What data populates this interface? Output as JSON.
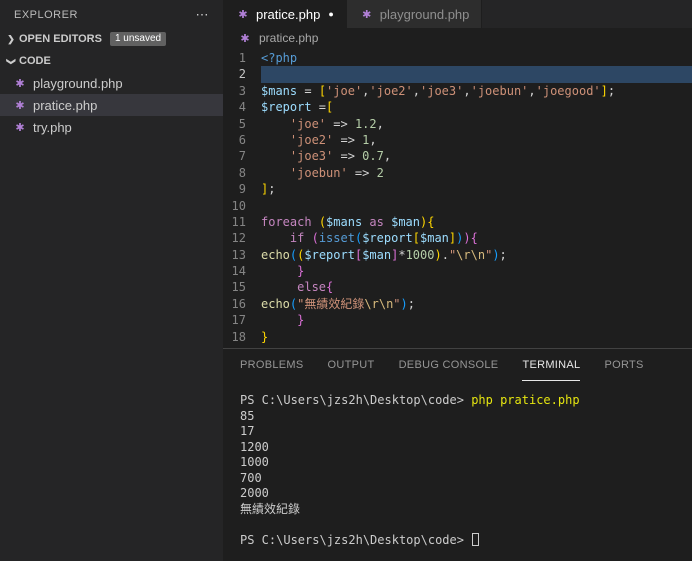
{
  "icons": {
    "php_file": "✱",
    "more": "⋯",
    "chevron_right": "❯",
    "modified_dot": "●"
  },
  "colors": {
    "php_icon_purple": "#b180d7",
    "sidebar_bg": "#252526",
    "editor_bg": "#1e1e1e",
    "selection_bg": "#37373d",
    "terminal_command_yellow": "#e5e510"
  },
  "sidebar": {
    "title": "EXPLORER",
    "open_editors": {
      "label": "OPEN EDITORS",
      "badge": "1 unsaved"
    },
    "folder": {
      "label": "CODE"
    },
    "files": [
      {
        "name": "playground.php",
        "selected": false
      },
      {
        "name": "pratice.php",
        "selected": true
      },
      {
        "name": "try.php",
        "selected": false
      }
    ]
  },
  "tabs": [
    {
      "label": "pratice.php",
      "active": true,
      "modified": true
    },
    {
      "label": "playground.php",
      "active": false,
      "modified": false
    }
  ],
  "breadcrumb": {
    "label": "pratice.php"
  },
  "editor": {
    "lines": [
      {
        "n": 1,
        "tokens": [
          [
            "<?php",
            "tag"
          ]
        ]
      },
      {
        "n": 2,
        "highlight": true,
        "tokens": []
      },
      {
        "n": 3,
        "tokens": [
          [
            "$mans",
            "var"
          ],
          [
            " = ",
            "fg"
          ],
          [
            "[",
            "b1"
          ],
          [
            "'joe'",
            "str"
          ],
          [
            ",",
            "fg"
          ],
          [
            "'joe2'",
            "str"
          ],
          [
            ",",
            "fg"
          ],
          [
            "'joe3'",
            "str"
          ],
          [
            ",",
            "fg"
          ],
          [
            "'joebun'",
            "str"
          ],
          [
            ",",
            "fg"
          ],
          [
            "'joegood'",
            "str"
          ],
          [
            "]",
            "b1"
          ],
          [
            ";",
            "fg"
          ]
        ]
      },
      {
        "n": 4,
        "tokens": [
          [
            "$report",
            "var"
          ],
          [
            " =",
            "fg"
          ],
          [
            "[",
            "b1"
          ]
        ]
      },
      {
        "n": 5,
        "tokens": [
          [
            "    ",
            "fg"
          ],
          [
            "'joe'",
            "str"
          ],
          [
            " => ",
            "fg"
          ],
          [
            "1.2",
            "num"
          ],
          [
            ",",
            "fg"
          ]
        ]
      },
      {
        "n": 6,
        "tokens": [
          [
            "    ",
            "fg"
          ],
          [
            "'joe2'",
            "str"
          ],
          [
            " => ",
            "fg"
          ],
          [
            "1",
            "num"
          ],
          [
            ",",
            "fg"
          ]
        ]
      },
      {
        "n": 7,
        "tokens": [
          [
            "    ",
            "fg"
          ],
          [
            "'joe3'",
            "str"
          ],
          [
            " => ",
            "fg"
          ],
          [
            "0.7",
            "num"
          ],
          [
            ",",
            "fg"
          ]
        ]
      },
      {
        "n": 8,
        "tokens": [
          [
            "    ",
            "fg"
          ],
          [
            "'joebun'",
            "str"
          ],
          [
            " => ",
            "fg"
          ],
          [
            "2",
            "num"
          ]
        ]
      },
      {
        "n": 9,
        "tokens": [
          [
            "]",
            "b1"
          ],
          [
            ";",
            "fg"
          ]
        ]
      },
      {
        "n": 10,
        "tokens": []
      },
      {
        "n": 11,
        "tokens": [
          [
            "foreach",
            "kw"
          ],
          [
            " ",
            "fg"
          ],
          [
            "(",
            "b1"
          ],
          [
            "$mans",
            "var"
          ],
          [
            " ",
            "fg"
          ],
          [
            "as",
            "kw"
          ],
          [
            " ",
            "fg"
          ],
          [
            "$man",
            "var"
          ],
          [
            ")",
            "b1"
          ],
          [
            "{",
            "b1"
          ]
        ]
      },
      {
        "n": 12,
        "tokens": [
          [
            "    ",
            "fg"
          ],
          [
            "if",
            "kw"
          ],
          [
            " ",
            "fg"
          ],
          [
            "(",
            "b2"
          ],
          [
            "isset",
            "tag"
          ],
          [
            "(",
            "b3"
          ],
          [
            "$report",
            "var"
          ],
          [
            "[",
            "b1"
          ],
          [
            "$man",
            "var"
          ],
          [
            "]",
            "b1"
          ],
          [
            ")",
            "b3"
          ],
          [
            ")",
            "b2"
          ],
          [
            "{",
            "b2"
          ]
        ]
      },
      {
        "n": 13,
        "tokens": [
          [
            "echo",
            "fn"
          ],
          [
            "(",
            "b3"
          ],
          [
            "(",
            "b1"
          ],
          [
            "$report",
            "var"
          ],
          [
            "[",
            "b2"
          ],
          [
            "$man",
            "var"
          ],
          [
            "]",
            "b2"
          ],
          [
            "*",
            "fg"
          ],
          [
            "1000",
            "num"
          ],
          [
            ")",
            "b1"
          ],
          [
            ".",
            "fg"
          ],
          [
            "\"",
            "str"
          ],
          [
            "\\r",
            "esc"
          ],
          [
            "\\n",
            "esc"
          ],
          [
            "\"",
            "str"
          ],
          [
            ")",
            "b3"
          ],
          [
            ";",
            "fg"
          ]
        ]
      },
      {
        "n": 14,
        "tokens": [
          [
            "     ",
            "fg"
          ],
          [
            "}",
            "b2"
          ]
        ]
      },
      {
        "n": 15,
        "tokens": [
          [
            "     ",
            "fg"
          ],
          [
            "else",
            "kw"
          ],
          [
            "{",
            "b2"
          ]
        ]
      },
      {
        "n": 16,
        "tokens": [
          [
            "echo",
            "fn"
          ],
          [
            "(",
            "b3"
          ],
          [
            "\"",
            "str"
          ],
          [
            "無績效紀錄",
            "str"
          ],
          [
            "\\r",
            "esc"
          ],
          [
            "\\n",
            "esc"
          ],
          [
            "\"",
            "str"
          ],
          [
            ")",
            "b3"
          ],
          [
            ";",
            "fg"
          ]
        ]
      },
      {
        "n": 17,
        "tokens": [
          [
            "     ",
            "fg"
          ],
          [
            "}",
            "b2"
          ]
        ]
      },
      {
        "n": 18,
        "tokens": [
          [
            "}",
            "b1"
          ]
        ]
      }
    ]
  },
  "panel": {
    "tabs": [
      "PROBLEMS",
      "OUTPUT",
      "DEBUG CONSOLE",
      "TERMINAL",
      "PORTS"
    ],
    "active_tab": "TERMINAL",
    "terminal_lines": [
      {
        "tokens": [
          [
            "PS C:\\Users\\jzs2h\\Desktop\\code> ",
            "plain"
          ],
          [
            "php pratice.php",
            "command"
          ]
        ]
      },
      {
        "tokens": [
          [
            "85",
            "plain"
          ]
        ]
      },
      {
        "tokens": [
          [
            "17",
            "plain"
          ]
        ]
      },
      {
        "tokens": [
          [
            "1200",
            "plain"
          ]
        ]
      },
      {
        "tokens": [
          [
            "1000",
            "plain"
          ]
        ]
      },
      {
        "tokens": [
          [
            "700",
            "plain"
          ]
        ]
      },
      {
        "tokens": [
          [
            "2000",
            "plain"
          ]
        ]
      },
      {
        "tokens": [
          [
            "無績效紀錄",
            "plain"
          ]
        ]
      },
      {
        "tokens": []
      },
      {
        "tokens": [
          [
            "PS C:\\Users\\jzs2h\\Desktop\\code> ",
            "plain"
          ]
        ],
        "cursor": true
      }
    ]
  }
}
